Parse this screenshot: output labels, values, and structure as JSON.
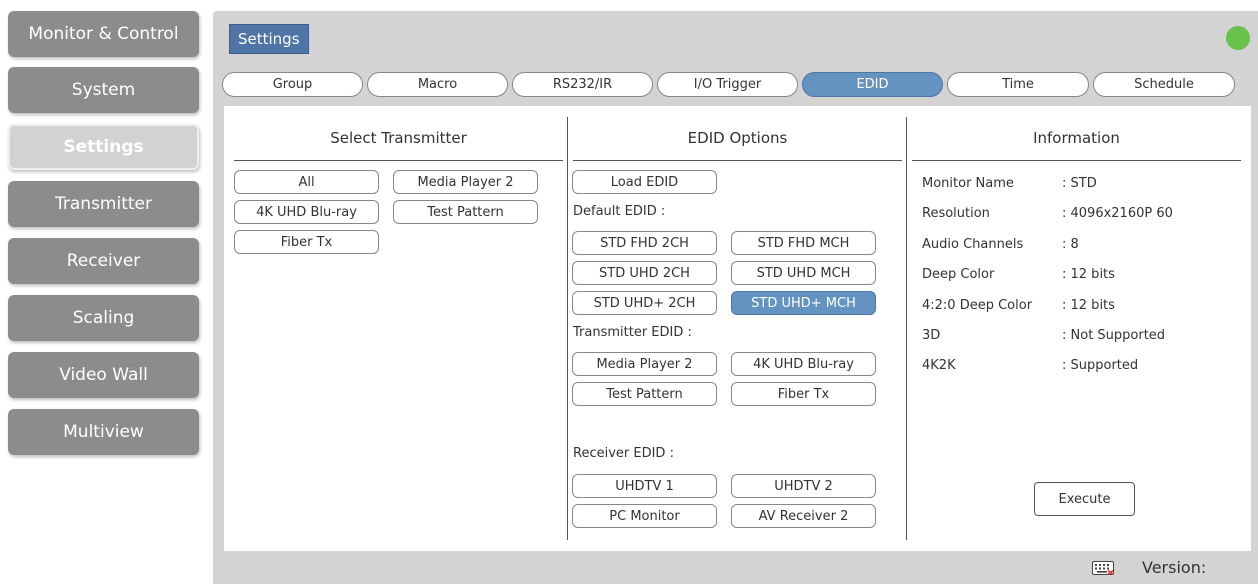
{
  "sidebar": {
    "items": [
      {
        "label": "Monitor & Control",
        "active": false
      },
      {
        "label": "System",
        "active": false
      },
      {
        "label": "Settings",
        "active": true
      },
      {
        "label": "Transmitter",
        "active": false
      },
      {
        "label": "Receiver",
        "active": false
      },
      {
        "label": "Scaling",
        "active": false
      },
      {
        "label": "Video Wall",
        "active": false
      },
      {
        "label": "Multiview",
        "active": false
      }
    ]
  },
  "header": {
    "title": "Settings",
    "status_color": "#68c24c"
  },
  "tabs": [
    {
      "label": "Group"
    },
    {
      "label": "Macro"
    },
    {
      "label": "RS232/IR"
    },
    {
      "label": "I/O Trigger"
    },
    {
      "label": "EDID",
      "active": true
    },
    {
      "label": "Time"
    },
    {
      "label": "Schedule"
    }
  ],
  "transmitter": {
    "title": "Select Transmitter",
    "buttons": [
      "All",
      "Media Player 2",
      "4K UHD Blu-ray",
      "Test Pattern",
      "Fiber Tx"
    ]
  },
  "edid": {
    "title": "EDID Options",
    "load_label": "Load EDID",
    "default_label": "Default EDID :",
    "default_buttons": [
      "STD FHD 2CH",
      "STD FHD MCH",
      "STD UHD 2CH",
      "STD UHD MCH",
      "STD UHD+ 2CH",
      "STD UHD+ MCH"
    ],
    "selected_default": "STD UHD+ MCH",
    "transmitter_label": "Transmitter EDID :",
    "transmitter_buttons": [
      "Media Player 2",
      "4K UHD Blu-ray",
      "Test Pattern",
      "Fiber Tx"
    ],
    "receiver_label": "Receiver EDID :",
    "receiver_buttons": [
      "UHDTV 1",
      "UHDTV 2",
      "PC Monitor",
      "AV Receiver 2"
    ]
  },
  "information": {
    "title": "Information",
    "rows": [
      {
        "key": "Monitor Name",
        "value": ": STD"
      },
      {
        "key": "Resolution",
        "value": ": 4096x2160P 60"
      },
      {
        "key": "Audio Channels",
        "value": ": 8"
      },
      {
        "key": "Deep Color",
        "value": ": 12 bits"
      },
      {
        "key": "4:2:0 Deep Color",
        "value": ": 12 bits"
      },
      {
        "key": "3D",
        "value": ": Not Supported"
      },
      {
        "key": "4K2K",
        "value": ": Supported"
      }
    ],
    "execute_label": "Execute"
  },
  "footer": {
    "version_label": "Version:",
    "keyboard_icon": "keyboard-icon"
  }
}
